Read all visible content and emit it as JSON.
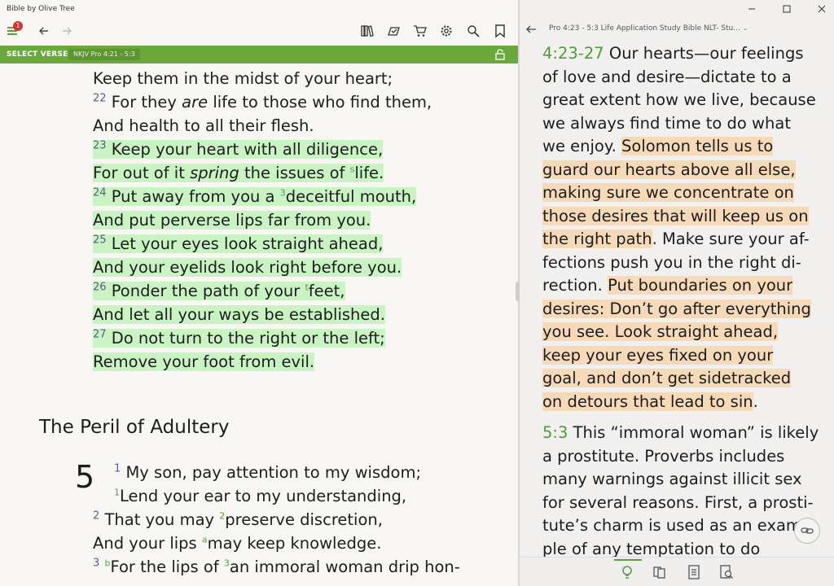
{
  "app": {
    "title": "Bible by Olive Tree",
    "notification_count": "1"
  },
  "left": {
    "select_verse_label": "SELECT VERSE",
    "reference_chip": "NKJV Pro 4:21 - 5:3",
    "lines": [
      {
        "parts": [
          {
            "t": "Keep them in the midst of your heart;"
          }
        ]
      },
      {
        "parts": [
          {
            "v": "22"
          },
          {
            "t": " For they "
          },
          {
            "i": "are"
          },
          {
            "t": " life to those who find them,"
          }
        ]
      },
      {
        "parts": [
          {
            "t": "And health to all their flesh."
          }
        ]
      },
      {
        "hl": true,
        "parts": [
          {
            "v": "23"
          },
          {
            "t": " Keep your heart with all diligence,"
          }
        ]
      },
      {
        "hl": true,
        "parts": [
          {
            "t": "For out of it "
          },
          {
            "i": "spring"
          },
          {
            "t": " the issues of "
          },
          {
            "fn": "s"
          },
          {
            "t": "life."
          }
        ]
      },
      {
        "hl": true,
        "parts": [
          {
            "v": "24"
          },
          {
            "t": " Put away from you a "
          },
          {
            "fn": "3"
          },
          {
            "t": "deceitful mouth,"
          }
        ]
      },
      {
        "hl": true,
        "parts": [
          {
            "t": "And put perverse lips far from you."
          }
        ]
      },
      {
        "hl": true,
        "parts": [
          {
            "v": "25"
          },
          {
            "t": " Let your eyes look straight ahead,"
          }
        ]
      },
      {
        "hl": true,
        "parts": [
          {
            "t": "And your eyelids look right before you."
          }
        ]
      },
      {
        "hl": true,
        "parts": [
          {
            "v": "26"
          },
          {
            "t": " Ponder the path of your "
          },
          {
            "fn": "t"
          },
          {
            "t": "feet,"
          }
        ]
      },
      {
        "hl": true,
        "parts": [
          {
            "t": "And let all your ways be established."
          }
        ]
      },
      {
        "hl": true,
        "parts": [
          {
            "v": "27"
          },
          {
            "t": " Do not turn to the right or the left;"
          }
        ]
      },
      {
        "hl": true,
        "parts": [
          {
            "t": "Remove your foot from evil."
          }
        ]
      }
    ],
    "heading": "The Peril of Adultery",
    "chapter": "5",
    "ch5_lines": [
      {
        "parts": [
          {
            "v": "1"
          },
          {
            "t": " My son, pay attention to my wisdom;"
          }
        ]
      },
      {
        "parts": [
          {
            "fn": "1"
          },
          {
            "t": "Lend your ear to my understanding,"
          }
        ]
      },
      {
        "parts": [
          {
            "v": "2"
          },
          {
            "t": " That you may "
          },
          {
            "fn": "2"
          },
          {
            "t": "preserve discretion,"
          }
        ]
      },
      {
        "parts": [
          {
            "t": "And your lips "
          },
          {
            "fn": "a"
          },
          {
            "t": "may keep knowledge."
          }
        ]
      },
      {
        "parts": [
          {
            "v": "3"
          },
          {
            "t": " "
          },
          {
            "fn": "b"
          },
          {
            "t": "For the lips of "
          },
          {
            "fn": "3"
          },
          {
            "t": "an immoral woman drip hon-"
          }
        ]
      }
    ]
  },
  "right": {
    "title": "Pro 4:23 - 5:3 Life Application Study Bible NLT-  Stu...",
    "note_lines": [
      {
        "parts": [
          {
            "r": "4:23-27"
          },
          {
            "t": " Our hearts—our feelings"
          }
        ]
      },
      {
        "parts": [
          {
            "t": "of love and desire—dictate to a"
          }
        ]
      },
      {
        "parts": [
          {
            "t": "great extent how we live, because"
          }
        ]
      },
      {
        "parts": [
          {
            "t": "we always find time to do what"
          }
        ]
      },
      {
        "parts": [
          {
            "t": "we enjoy. "
          },
          {
            "h": "Solomon tells us to"
          }
        ]
      },
      {
        "parts": [
          {
            "h": "guard our hearts above all else,"
          }
        ]
      },
      {
        "parts": [
          {
            "h": "making sure we concentrate on"
          }
        ]
      },
      {
        "parts": [
          {
            "h": "those desires that will keep us on"
          }
        ]
      },
      {
        "parts": [
          {
            "h": "the right path"
          },
          {
            "t": ". Make sure your af-"
          }
        ]
      },
      {
        "parts": [
          {
            "t": "fections push you in the right di-"
          }
        ]
      },
      {
        "parts": [
          {
            "t": "rection. "
          },
          {
            "h": "Put boundaries on your"
          }
        ]
      },
      {
        "parts": [
          {
            "h": "desires: Don’t go after everything"
          }
        ]
      },
      {
        "parts": [
          {
            "h": "you see. Look straight ahead,"
          }
        ]
      },
      {
        "parts": [
          {
            "h": "keep your eyes fixed on your"
          }
        ]
      },
      {
        "parts": [
          {
            "h": "goal, and don’t get sidetracked"
          }
        ]
      },
      {
        "parts": [
          {
            "h": "on detours that lead to sin"
          },
          {
            "t": "."
          }
        ]
      },
      {
        "gap": true,
        "parts": [
          {
            "r": "5:3"
          },
          {
            "t": " This “immoral woman” is likely"
          }
        ]
      },
      {
        "parts": [
          {
            "t": "a prostitute. Proverbs includes"
          }
        ]
      },
      {
        "parts": [
          {
            "t": "many warnings against illicit sex"
          }
        ]
      },
      {
        "parts": [
          {
            "t": "for several reasons. First, a prosti-"
          }
        ]
      },
      {
        "parts": [
          {
            "t": "tute’s charm is used as an exam-"
          }
        ]
      },
      {
        "parts": [
          {
            "t": "ple of any temptation to do"
          }
        ]
      }
    ]
  },
  "colors": {
    "accent_green": "#6ba83c",
    "verse_highlight": "#c9f3c3",
    "note_highlight": "#f6d9b8",
    "ref_green": "#4f9b3c"
  }
}
